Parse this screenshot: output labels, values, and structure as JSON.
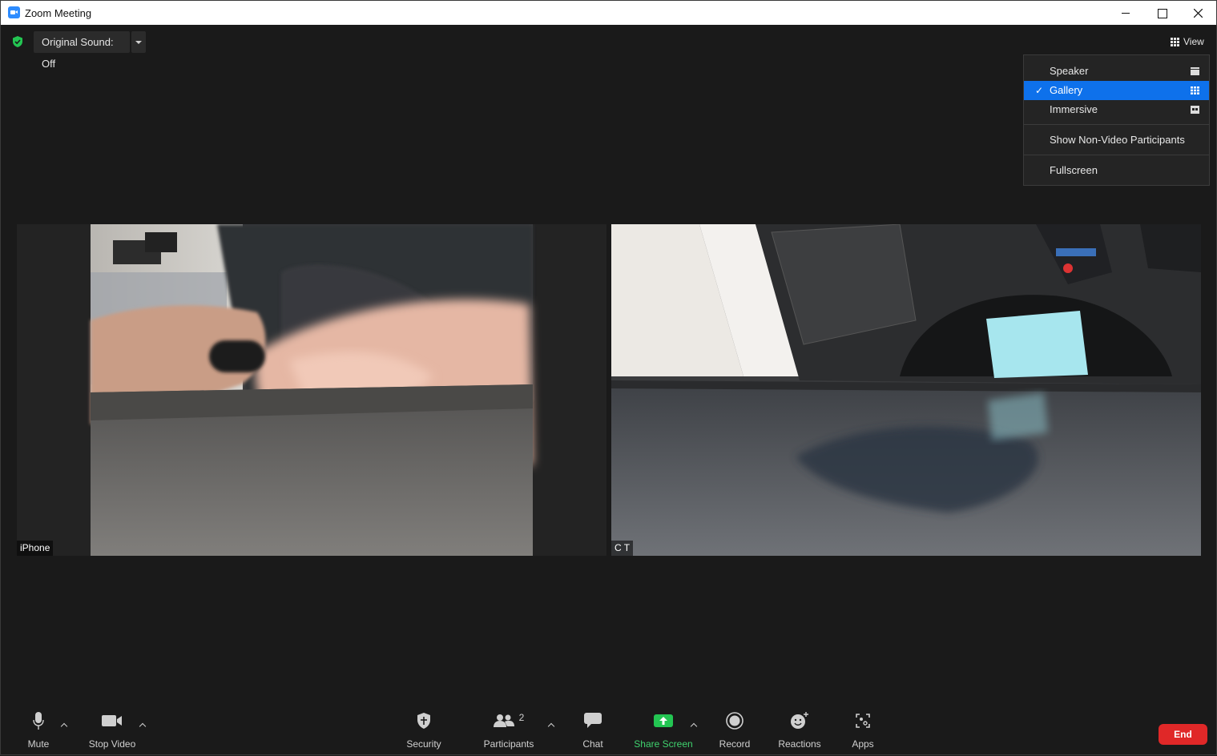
{
  "window": {
    "title": "Zoom Meeting"
  },
  "topbar": {
    "original_sound": "Original Sound: Off",
    "view_label": "View"
  },
  "view_menu": {
    "items": [
      {
        "label": "Speaker",
        "selected": false,
        "icon": "speaker-view-icon"
      },
      {
        "label": "Gallery",
        "selected": true,
        "icon": "gallery-view-icon"
      },
      {
        "label": "Immersive",
        "selected": false,
        "icon": "immersive-view-icon"
      }
    ],
    "show_non_video": "Show Non-Video Participants",
    "fullscreen": "Fullscreen"
  },
  "participants": [
    {
      "name": "iPhone"
    },
    {
      "name": "C T"
    }
  ],
  "toolbar": {
    "mute": "Mute",
    "stop_video": "Stop Video",
    "security": "Security",
    "participants": "Participants",
    "participant_count": "2",
    "chat": "Chat",
    "share_screen": "Share Screen",
    "record": "Record",
    "reactions": "Reactions",
    "apps": "Apps",
    "end": "End"
  },
  "colors": {
    "accent_blue": "#0e71eb",
    "share_green": "#3fd26e",
    "end_red": "#e02828",
    "secure_green": "#23c552"
  }
}
